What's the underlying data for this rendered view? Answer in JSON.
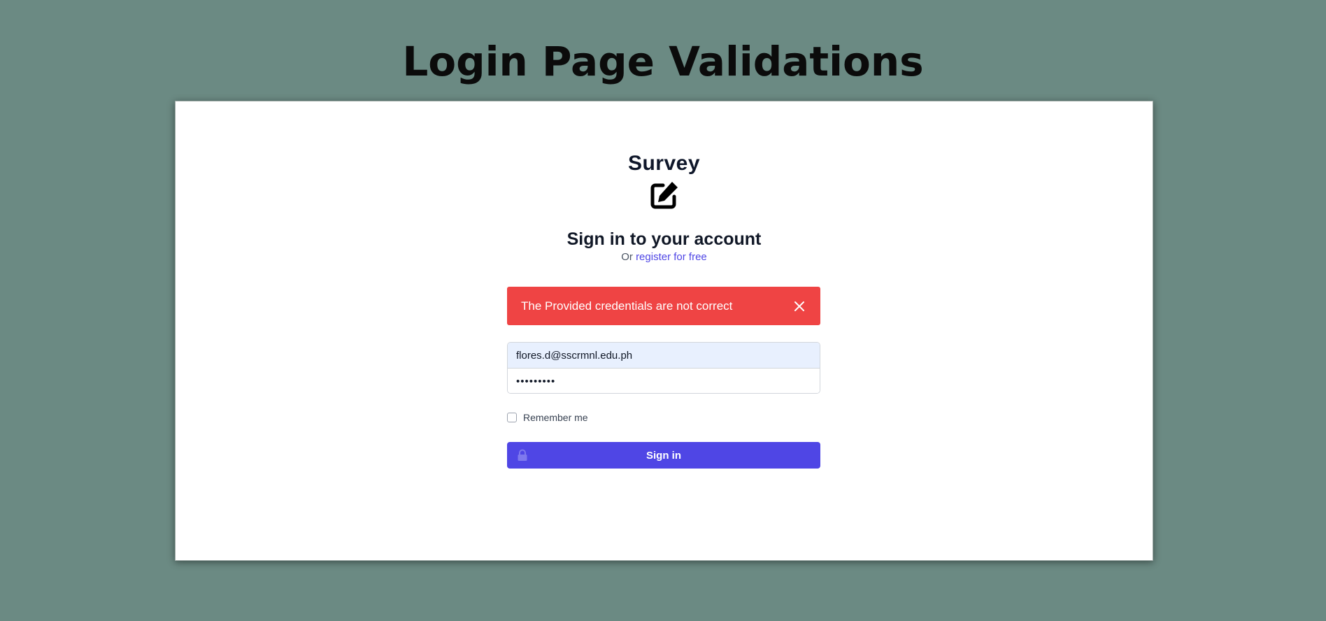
{
  "page": {
    "title": "Login Page Validations"
  },
  "brand": {
    "name": "Survey",
    "icon": "edit-icon"
  },
  "login": {
    "heading": "Sign in to your account",
    "subheading_prefix": "Or",
    "register_link": "register for free",
    "error": {
      "message": "The Provided credentials are not correct",
      "color": "#ef4444",
      "close_icon": "close-icon"
    },
    "email": {
      "value": "flores.d@sscrmnl.edu.ph"
    },
    "password": {
      "value": "•••••••••"
    },
    "remember_label": "Remember me",
    "remember_checked": false,
    "submit_label": "Sign in",
    "submit_icon": "lock-icon",
    "accent": "#4f46e5"
  }
}
